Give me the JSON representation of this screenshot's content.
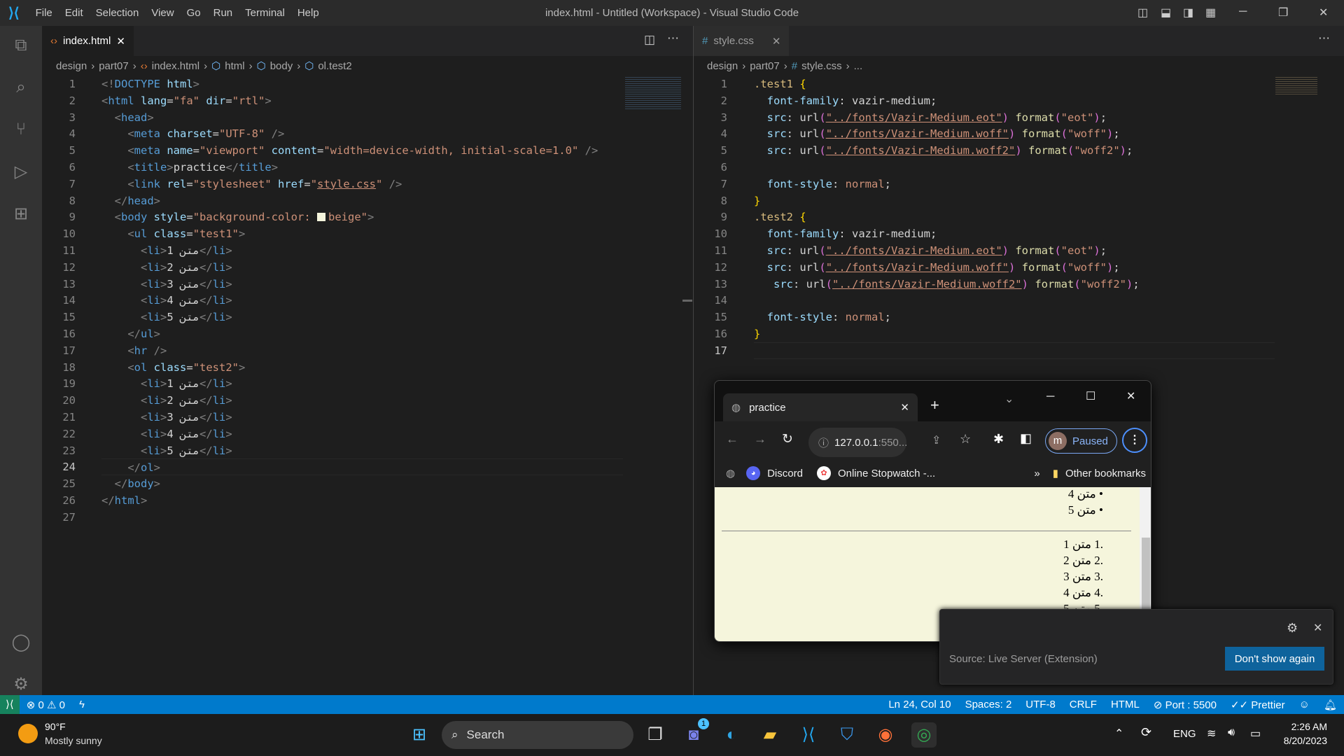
{
  "window": {
    "title": "index.html - Untitled (Workspace) - Visual Studio Code",
    "menu": [
      "File",
      "Edit",
      "Selection",
      "View",
      "Go",
      "Run",
      "Terminal",
      "Help"
    ]
  },
  "left_editor": {
    "tab": "index.html",
    "breadcrumb": [
      "design",
      "part07",
      "index.html",
      "html",
      "body",
      "ol.test2"
    ],
    "current_line": 24,
    "lines": [
      [
        [
          "<!",
          "p"
        ],
        [
          "DOCTYPE ",
          "t"
        ],
        [
          "html",
          "a"
        ],
        [
          ">",
          "p"
        ]
      ],
      [
        [
          "<",
          "p"
        ],
        [
          "html ",
          "t"
        ],
        [
          "lang",
          "a"
        ],
        [
          "=",
          "x"
        ],
        [
          "\"fa\" ",
          "s"
        ],
        [
          "dir",
          "a"
        ],
        [
          "=",
          "x"
        ],
        [
          "\"rtl\"",
          "s"
        ],
        [
          ">",
          "p"
        ]
      ],
      [
        [
          "  <",
          "p"
        ],
        [
          "head",
          "t"
        ],
        [
          ">",
          "p"
        ]
      ],
      [
        [
          "    <",
          "p"
        ],
        [
          "meta ",
          "t"
        ],
        [
          "charset",
          "a"
        ],
        [
          "=",
          "x"
        ],
        [
          "\"UTF-8\" ",
          "s"
        ],
        [
          "/>",
          "p"
        ]
      ],
      [
        [
          "    <",
          "p"
        ],
        [
          "meta ",
          "t"
        ],
        [
          "name",
          "a"
        ],
        [
          "=",
          "x"
        ],
        [
          "\"viewport\" ",
          "s"
        ],
        [
          "content",
          "a"
        ],
        [
          "=",
          "x"
        ],
        [
          "\"width=device-width, initial-scale=1.0\" ",
          "s"
        ],
        [
          "/>",
          "p"
        ]
      ],
      [
        [
          "    <",
          "p"
        ],
        [
          "title",
          "t"
        ],
        [
          ">",
          "p"
        ],
        [
          "practice",
          "x"
        ],
        [
          "</",
          "p"
        ],
        [
          "title",
          "t"
        ],
        [
          ">",
          "p"
        ]
      ],
      [
        [
          "    <",
          "p"
        ],
        [
          "link ",
          "t"
        ],
        [
          "rel",
          "a"
        ],
        [
          "=",
          "x"
        ],
        [
          "\"stylesheet\" ",
          "s"
        ],
        [
          "href",
          "a"
        ],
        [
          "=",
          "x"
        ],
        [
          "\"",
          "s"
        ],
        [
          "style.css",
          "s u"
        ],
        [
          "\" ",
          "s"
        ],
        [
          "/>",
          "p"
        ]
      ],
      [
        [
          "  </",
          "p"
        ],
        [
          "head",
          "t"
        ],
        [
          ">",
          "p"
        ]
      ],
      [
        [
          "  <",
          "p"
        ],
        [
          "body ",
          "t"
        ],
        [
          "style",
          "a"
        ],
        [
          "=",
          "x"
        ],
        [
          "\"background-color: ",
          "s"
        ],
        [
          "",
          "sw"
        ],
        [
          "beige\"",
          "s"
        ],
        [
          ">",
          "p"
        ]
      ],
      [
        [
          "    <",
          "p"
        ],
        [
          "ul ",
          "t"
        ],
        [
          "class",
          "a"
        ],
        [
          "=",
          "x"
        ],
        [
          "\"test1\"",
          "s"
        ],
        [
          ">",
          "p"
        ]
      ],
      [
        [
          "      <",
          "p"
        ],
        [
          "li",
          "t"
        ],
        [
          ">",
          "p"
        ],
        [
          "1 متن",
          "x"
        ],
        [
          "</",
          "p"
        ],
        [
          "li",
          "t"
        ],
        [
          ">",
          "p"
        ]
      ],
      [
        [
          "      <",
          "p"
        ],
        [
          "li",
          "t"
        ],
        [
          ">",
          "p"
        ],
        [
          "2 متن",
          "x"
        ],
        [
          "</",
          "p"
        ],
        [
          "li",
          "t"
        ],
        [
          ">",
          "p"
        ]
      ],
      [
        [
          "      <",
          "p"
        ],
        [
          "li",
          "t"
        ],
        [
          ">",
          "p"
        ],
        [
          "3 متن",
          "x"
        ],
        [
          "</",
          "p"
        ],
        [
          "li",
          "t"
        ],
        [
          ">",
          "p"
        ]
      ],
      [
        [
          "      <",
          "p"
        ],
        [
          "li",
          "t"
        ],
        [
          ">",
          "p"
        ],
        [
          "4 متن",
          "x"
        ],
        [
          "</",
          "p"
        ],
        [
          "li",
          "t"
        ],
        [
          ">",
          "p"
        ]
      ],
      [
        [
          "      <",
          "p"
        ],
        [
          "li",
          "t"
        ],
        [
          ">",
          "p"
        ],
        [
          "5 متن",
          "x"
        ],
        [
          "</",
          "p"
        ],
        [
          "li",
          "t"
        ],
        [
          ">",
          "p"
        ]
      ],
      [
        [
          "    </",
          "p"
        ],
        [
          "ul",
          "t"
        ],
        [
          ">",
          "p"
        ]
      ],
      [
        [
          "    <",
          "p"
        ],
        [
          "hr ",
          "t"
        ],
        [
          "/>",
          "p"
        ]
      ],
      [
        [
          "    <",
          "p"
        ],
        [
          "ol ",
          "t"
        ],
        [
          "class",
          "a"
        ],
        [
          "=",
          "x"
        ],
        [
          "\"test2\"",
          "s"
        ],
        [
          ">",
          "p"
        ]
      ],
      [
        [
          "      <",
          "p"
        ],
        [
          "li",
          "t"
        ],
        [
          ">",
          "p"
        ],
        [
          "1 متن",
          "x"
        ],
        [
          "</",
          "p"
        ],
        [
          "li",
          "t"
        ],
        [
          ">",
          "p"
        ]
      ],
      [
        [
          "      <",
          "p"
        ],
        [
          "li",
          "t"
        ],
        [
          ">",
          "p"
        ],
        [
          "2 متن",
          "x"
        ],
        [
          "</",
          "p"
        ],
        [
          "li",
          "t"
        ],
        [
          ">",
          "p"
        ]
      ],
      [
        [
          "      <",
          "p"
        ],
        [
          "li",
          "t"
        ],
        [
          ">",
          "p"
        ],
        [
          "3 متن",
          "x"
        ],
        [
          "</",
          "p"
        ],
        [
          "li",
          "t"
        ],
        [
          ">",
          "p"
        ]
      ],
      [
        [
          "      <",
          "p"
        ],
        [
          "li",
          "t"
        ],
        [
          ">",
          "p"
        ],
        [
          "4 متن",
          "x"
        ],
        [
          "</",
          "p"
        ],
        [
          "li",
          "t"
        ],
        [
          ">",
          "p"
        ]
      ],
      [
        [
          "      <",
          "p"
        ],
        [
          "li",
          "t"
        ],
        [
          ">",
          "p"
        ],
        [
          "5 متن",
          "x"
        ],
        [
          "</",
          "p"
        ],
        [
          "li",
          "t"
        ],
        [
          ">",
          "p"
        ]
      ],
      [
        [
          "    </",
          "p"
        ],
        [
          "ol",
          "t"
        ],
        [
          ">",
          "p"
        ]
      ],
      [
        [
          "  </",
          "p"
        ],
        [
          "body",
          "t"
        ],
        [
          ">",
          "p"
        ]
      ],
      [
        [
          "</",
          "p"
        ],
        [
          "html",
          "t"
        ],
        [
          ">",
          "p"
        ]
      ],
      []
    ]
  },
  "right_editor": {
    "tab": "style.css",
    "breadcrumb": [
      "design",
      "part07",
      "style.css",
      "..."
    ],
    "current_line": 17,
    "lines": [
      [
        [
          ".test1 ",
          "sel"
        ],
        [
          "{",
          "b1"
        ]
      ],
      [
        [
          "  font-family",
          "pr"
        ],
        [
          ": vazir-medium;",
          "x"
        ]
      ],
      [
        [
          "  src",
          "pr"
        ],
        [
          ": url",
          "x"
        ],
        [
          "(",
          "b2"
        ],
        [
          "\"../fonts/Vazir-Medium.eot\"",
          "v u"
        ],
        [
          ")",
          "b2"
        ],
        [
          " format",
          "f"
        ],
        [
          "(",
          "b2"
        ],
        [
          "\"eot\"",
          "v"
        ],
        [
          ")",
          "b2"
        ],
        [
          ";",
          "x"
        ]
      ],
      [
        [
          "  src",
          "pr"
        ],
        [
          ": url",
          "x"
        ],
        [
          "(",
          "b2"
        ],
        [
          "\"../fonts/Vazir-Medium.woff\"",
          "v u"
        ],
        [
          ")",
          "b2"
        ],
        [
          " format",
          "f"
        ],
        [
          "(",
          "b2"
        ],
        [
          "\"woff\"",
          "v"
        ],
        [
          ")",
          "b2"
        ],
        [
          ";",
          "x"
        ]
      ],
      [
        [
          "  src",
          "pr"
        ],
        [
          ": url",
          "x"
        ],
        [
          "(",
          "b2"
        ],
        [
          "\"../fonts/Vazir-Medium.woff2\"",
          "v u"
        ],
        [
          ")",
          "b2"
        ],
        [
          " format",
          "f"
        ],
        [
          "(",
          "b2"
        ],
        [
          "\"woff2\"",
          "v"
        ],
        [
          ")",
          "b2"
        ],
        [
          ";",
          "x"
        ]
      ],
      [],
      [
        [
          "  font-style",
          "pr"
        ],
        [
          ": ",
          "x"
        ],
        [
          "normal",
          "v"
        ],
        [
          ";",
          "x"
        ]
      ],
      [
        [
          "}",
          "b1"
        ]
      ],
      [
        [
          ".test2 ",
          "sel"
        ],
        [
          "{",
          "b1"
        ]
      ],
      [
        [
          "  font-family",
          "pr"
        ],
        [
          ": vazir-medium;",
          "x"
        ]
      ],
      [
        [
          "  src",
          "pr"
        ],
        [
          ": url",
          "x"
        ],
        [
          "(",
          "b2"
        ],
        [
          "\"../fonts/Vazir-Medium.eot\"",
          "v u"
        ],
        [
          ")",
          "b2"
        ],
        [
          " format",
          "f"
        ],
        [
          "(",
          "b2"
        ],
        [
          "\"eot\"",
          "v"
        ],
        [
          ")",
          "b2"
        ],
        [
          ";",
          "x"
        ]
      ],
      [
        [
          "  src",
          "pr"
        ],
        [
          ": url",
          "x"
        ],
        [
          "(",
          "b2"
        ],
        [
          "\"../fonts/Vazir-Medium.woff\"",
          "v u"
        ],
        [
          ")",
          "b2"
        ],
        [
          " format",
          "f"
        ],
        [
          "(",
          "b2"
        ],
        [
          "\"woff\"",
          "v"
        ],
        [
          ")",
          "b2"
        ],
        [
          ";",
          "x"
        ]
      ],
      [
        [
          "   src",
          "pr"
        ],
        [
          ": url",
          "x"
        ],
        [
          "(",
          "b2"
        ],
        [
          "\"../fonts/Vazir-Medium.woff2\"",
          "v u"
        ],
        [
          ")",
          "b2"
        ],
        [
          " format",
          "f"
        ],
        [
          "(",
          "b2"
        ],
        [
          "\"woff2\"",
          "v"
        ],
        [
          ")",
          "b2"
        ],
        [
          ";",
          "x"
        ]
      ],
      [],
      [
        [
          "  font-style",
          "pr"
        ],
        [
          ": ",
          "x"
        ],
        [
          "normal",
          "v"
        ],
        [
          ";",
          "x"
        ]
      ],
      [
        [
          "}",
          "b1"
        ]
      ],
      []
    ]
  },
  "browser": {
    "tab_title": "practice",
    "address_host": "127.0.0.1",
    "address_rest": ":550...",
    "profile_initial": "m",
    "profile_status": "Paused",
    "bookmarks": [
      "Discord",
      "Online Stopwatch -...",
      "»",
      "Other bookmarks"
    ],
    "ul_items": [
      "متن 4",
      "متن 5"
    ],
    "ol_items": [
      "متن 1",
      "متن 2",
      "متن 3",
      "متن 4",
      "متن 5"
    ],
    "ol_numbers": [
      ".1",
      ".2",
      ".3",
      ".4",
      ".5"
    ]
  },
  "notification": {
    "source": "Source: Live Server (Extension)",
    "button": "Don't show again"
  },
  "statusbar": {
    "errors": "0",
    "warnings": "0",
    "position": "Ln 24, Col 10",
    "spaces": "Spaces: 2",
    "encoding": "UTF-8",
    "eol": "CRLF",
    "language": "HTML",
    "port": "Port : 5500",
    "prettier": "Prettier"
  },
  "taskbar": {
    "weather_temp": "90°F",
    "weather_desc": "Mostly sunny",
    "search": "Search",
    "lang": "ENG",
    "time": "2:26 AM",
    "date": "8/20/2023",
    "badge": "1"
  },
  "colors": {
    "accent": "#007acc",
    "beige": "#f5f5dc",
    "remote": "#16825d"
  }
}
